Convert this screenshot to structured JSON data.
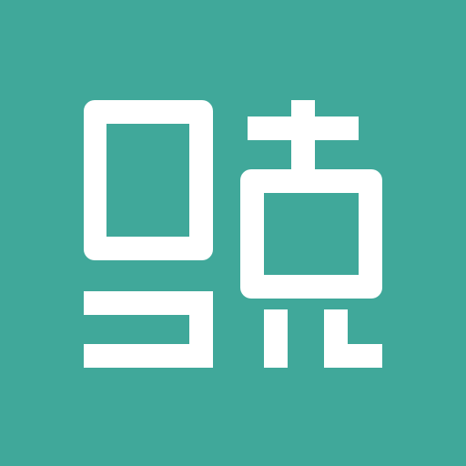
{
  "icon": {
    "name": "layout-glyph-icon",
    "background_color": "#40A89A",
    "foreground_color": "#FFFFFF"
  }
}
